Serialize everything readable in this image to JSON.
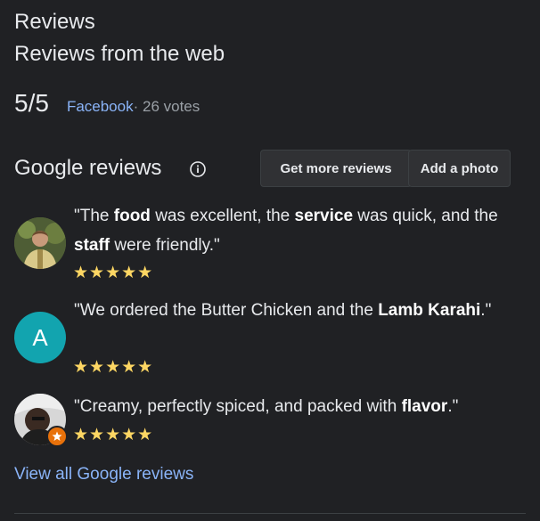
{
  "header": {
    "title": "Reviews",
    "subtitle": "Reviews from the web"
  },
  "web_rating": {
    "score": "5/5",
    "source": "Facebook",
    "votes": " · 26 votes"
  },
  "google_reviews": {
    "title": "Google reviews",
    "get_more_label": "Get more reviews",
    "add_photo_label": "Add a photo",
    "reviews": [
      {
        "text_parts": [
          "\"The ",
          "food",
          " was excellent, the ",
          "service",
          " was quick, and the ",
          "staff",
          " were friendly.\""
        ],
        "stars": 5,
        "avatar": "photo-avatar"
      },
      {
        "text_parts": [
          "\"We ordered the Butter Chicken and the ",
          "Lamb Karahi",
          ".\""
        ],
        "stars": 5,
        "avatar_letter": "A",
        "avatar_color": "#12a4af"
      },
      {
        "text_parts": [
          "\"Creamy, perfectly spiced, and packed with ",
          "flavor",
          ".\""
        ],
        "stars": 5,
        "avatar": "photo-avatar",
        "badge_color": "#e8710a"
      }
    ],
    "view_all_label": "View all Google reviews"
  },
  "colors": {
    "background": "#202124",
    "link": "#8ab4f8",
    "star": "#fdd663"
  }
}
